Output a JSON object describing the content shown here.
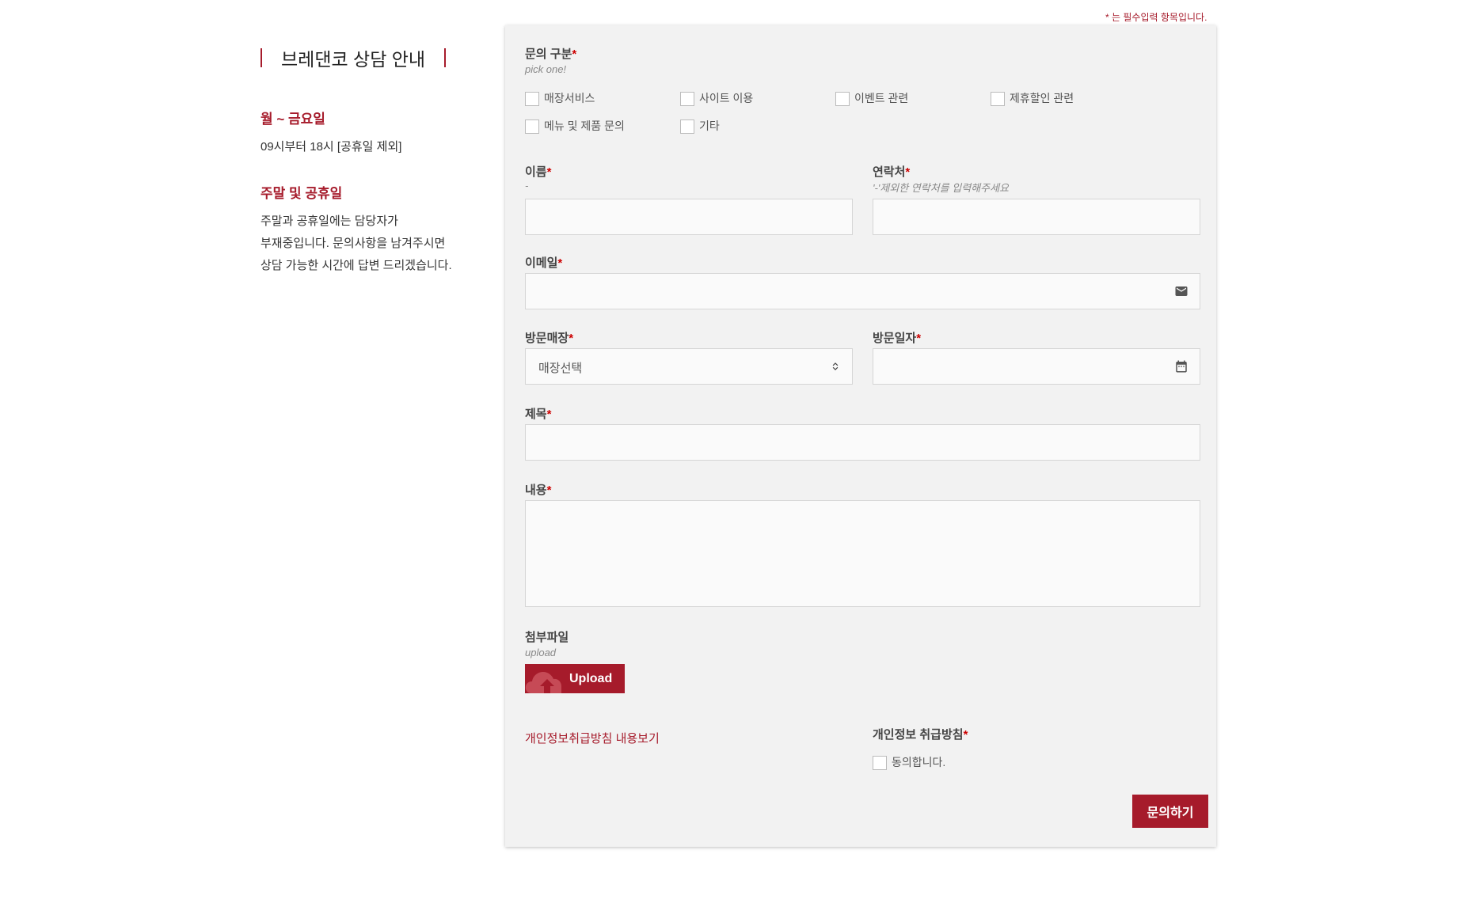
{
  "required_note": "* 는 필수입력 항목입니다.",
  "info": {
    "title": "브레댄코 상담 안내",
    "weekday_head": "월 ~ 금요일",
    "weekday_text": "09시부터 18시 [공휴일 제외]",
    "weekend_head": "주말 및 공휴일",
    "weekend_lines": [
      "주말과 공휴일에는 담당자가",
      "부재중입니다. 문의사항을 남겨주시면",
      "상담 가능한 시간에 답변 드리겠습니다."
    ]
  },
  "form": {
    "category": {
      "label": "문의 구분",
      "hint": "pick one!",
      "options": [
        "매장서비스",
        "사이트 이용",
        "이벤트 관련",
        "제휴할인 관련",
        "메뉴 및 제품 문의",
        "기타"
      ]
    },
    "name": {
      "label": "이름",
      "hint": "-",
      "value": ""
    },
    "phone": {
      "label": "연락처",
      "hint": "'-'제외한 연락처를 입력해주세요",
      "value": ""
    },
    "email": {
      "label": "이메일",
      "value": "",
      "icon": "mail-icon"
    },
    "store": {
      "label": "방문매장",
      "selected": "매장선택",
      "icon": "select-arrows-icon"
    },
    "visit_date": {
      "label": "방문일자",
      "value": "",
      "icon": "calendar-icon"
    },
    "subject": {
      "label": "제목",
      "value": ""
    },
    "content": {
      "label": "내용",
      "value": ""
    },
    "attachment": {
      "label": "첨부파일",
      "hint": "upload",
      "button": "Upload",
      "icon": "cloud-upload-icon"
    },
    "privacy_link": "개인정보취급방침 내용보기",
    "privacy": {
      "label": "개인정보 취급방침",
      "agree": "동의합니다."
    },
    "submit": "문의하기",
    "required_mark": "*"
  },
  "colors": {
    "accent": "#a61b2b",
    "required": "#cc0000",
    "card_bg": "#f2f2f2",
    "field_bg": "#fafafa"
  }
}
